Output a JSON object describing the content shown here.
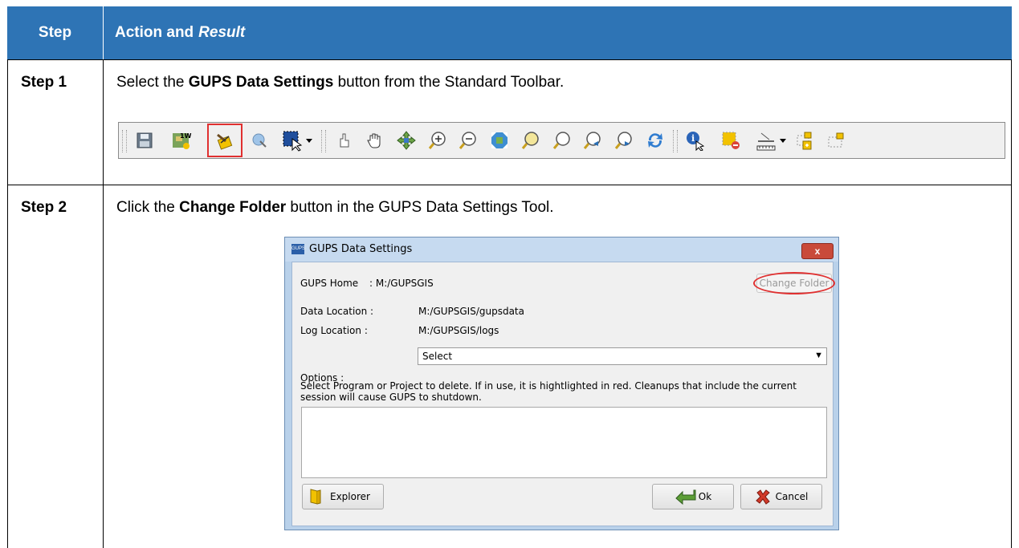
{
  "table": {
    "header": {
      "step": "Step",
      "action": "Action and",
      "result": "Result"
    },
    "rows": [
      {
        "step": "Step 1",
        "text_before": "Select the ",
        "bold": "GUPS Data Settings",
        "text_after": " button from the Standard Toolbar."
      },
      {
        "step": "Step 2",
        "text_before": "Click the ",
        "bold": "Change Folder",
        "text_after": " button in the GUPS Data Settings Tool."
      }
    ]
  },
  "toolbar": {
    "icons": [
      "save-icon",
      "new-project-icon",
      "data-settings-icon",
      "pan-to-selection-icon",
      "select-features-icon",
      "dropdown-arrow-icon",
      "touch-icon",
      "pan-hand-icon",
      "pan-map-icon",
      "zoom-in-icon",
      "zoom-out-icon",
      "zoom-full-icon",
      "zoom-layer-icon",
      "zoom-selection-icon",
      "zoom-last-icon",
      "zoom-next-icon",
      "refresh-icon",
      "identify-icon",
      "deselect-icon",
      "measure-icon",
      "dropdown-arrow-icon",
      "add-feature-icon",
      "move-label-icon"
    ],
    "highlighted": "data-settings-icon"
  },
  "dialog": {
    "title": "GUPS Data Settings",
    "title_badge": "GUPS",
    "close_label": "x",
    "gups_home_label": "GUPS Home",
    "gups_home_value": ": M:/GUPSGIS",
    "change_folder_label": "Change Folder",
    "data_location_label": "Data Location :",
    "data_location_value": "M:/GUPSGIS/gupsdata",
    "log_location_label": "Log Location :",
    "log_location_value": "M:/GUPSGIS/logs",
    "options_label": "Options :",
    "options_selected": "Select",
    "note_line1": "Select Program or Project to delete. If in use, it is hightlighted in red. Cleanups that include the current",
    "note_line2": "session will cause GUPS to shutdown.",
    "explorer_label": "Explorer",
    "ok_label": "Ok",
    "cancel_label": "Cancel"
  },
  "colors": {
    "header_bg": "#2e74b5",
    "highlight": "#e03030"
  }
}
